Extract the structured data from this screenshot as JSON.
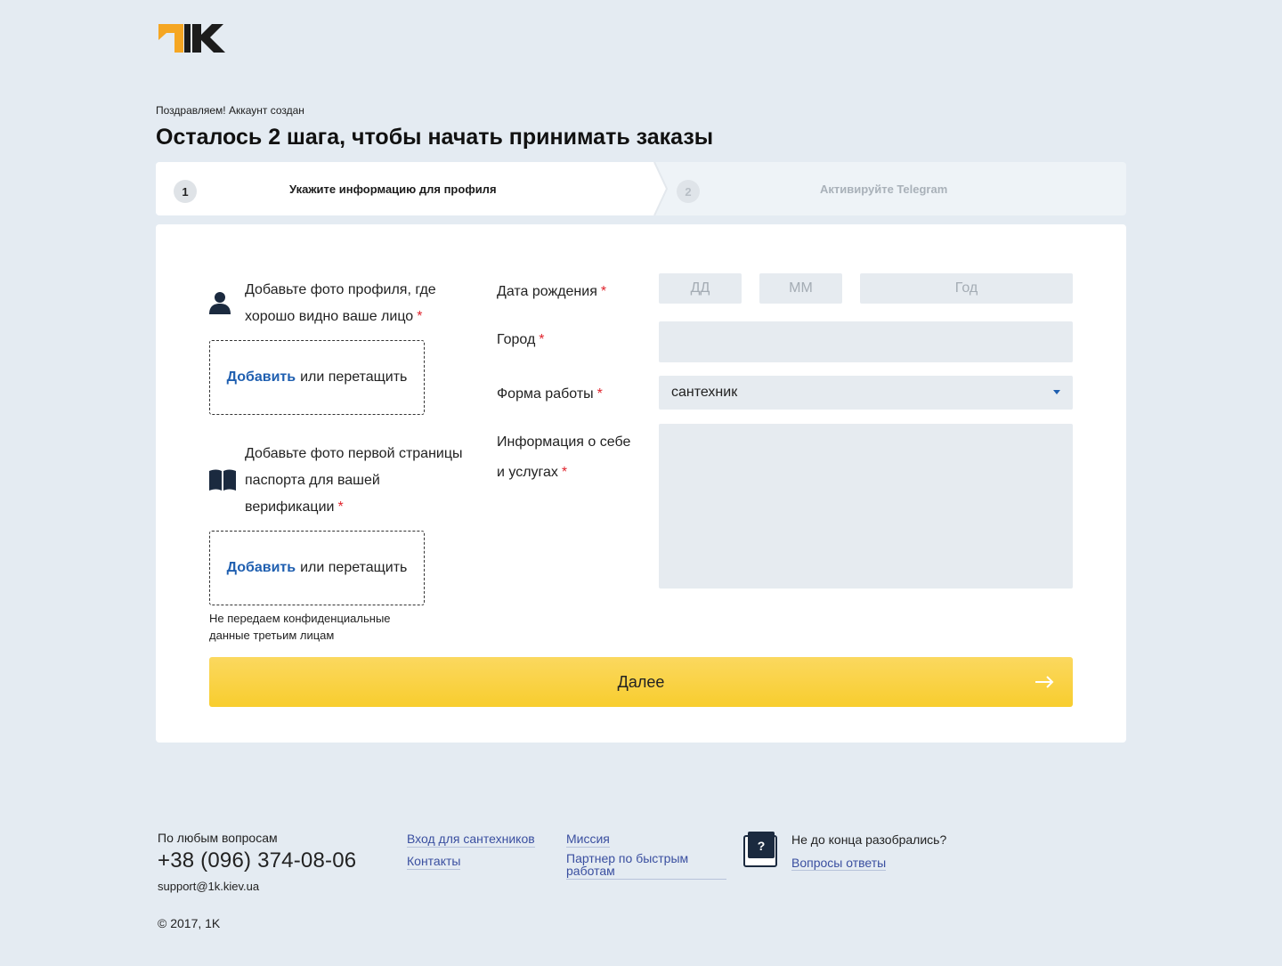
{
  "brand": {
    "name": "1K",
    "accent": "#f5a623",
    "dark": "#1c1c1c"
  },
  "header": {
    "subtitle": "Поздравляем! Аккаунт создан",
    "title": "Осталось 2 шага, чтобы начать принимать заказы"
  },
  "steps": [
    {
      "number": "1",
      "label": "Укажите информацию для профиля",
      "active": true
    },
    {
      "number": "2",
      "label": "Активируйте Telegram",
      "active": false
    }
  ],
  "uploads": {
    "profile": {
      "heading_line1": "Добавьте фото профиля, где",
      "heading_line2": "хорошо видно ваше лицо",
      "icon": "user-icon",
      "add": "Добавить",
      "drag": "или перетащить"
    },
    "passport": {
      "heading_line1": "Добавьте фото первой страницы",
      "heading_line2": "паспорта для вашей",
      "heading_line3": "верификации",
      "icon": "book-icon",
      "add": "Добавить",
      "drag": "или перетащить"
    },
    "note_line1": "Не передаем конфиденциальные",
    "note_line2": "данные третьим лицам",
    "required_mark": "*"
  },
  "form": {
    "birthdate_label": "Дата рождения",
    "day_placeholder": "ДД",
    "month_placeholder": "ММ",
    "year_placeholder": "Год",
    "city_label": "Город",
    "city_value": "",
    "work_form_label": "Форма работы",
    "work_form_value": "сантехник",
    "about_label_line1": "Информация о себе",
    "about_label_line2": "и услугах",
    "about_value": "",
    "required_mark": "*"
  },
  "next_button": {
    "label": "Далее",
    "color": "#f8cd2e"
  },
  "footer": {
    "questions": "По любым вопросам",
    "phone": "+38 (096) 374-08-06",
    "email": "support@1k.kiev.ua",
    "copyright": "© 2017, 1K",
    "links_col1": [
      "Вход для сантехников",
      "Контакты"
    ],
    "links_col2": [
      "Миссия",
      "Партнер по быстрым работам"
    ],
    "help_question": "Не до конца разобрались?",
    "faq_link": "Вопросы ответы",
    "help_icon_glyph": "?"
  }
}
